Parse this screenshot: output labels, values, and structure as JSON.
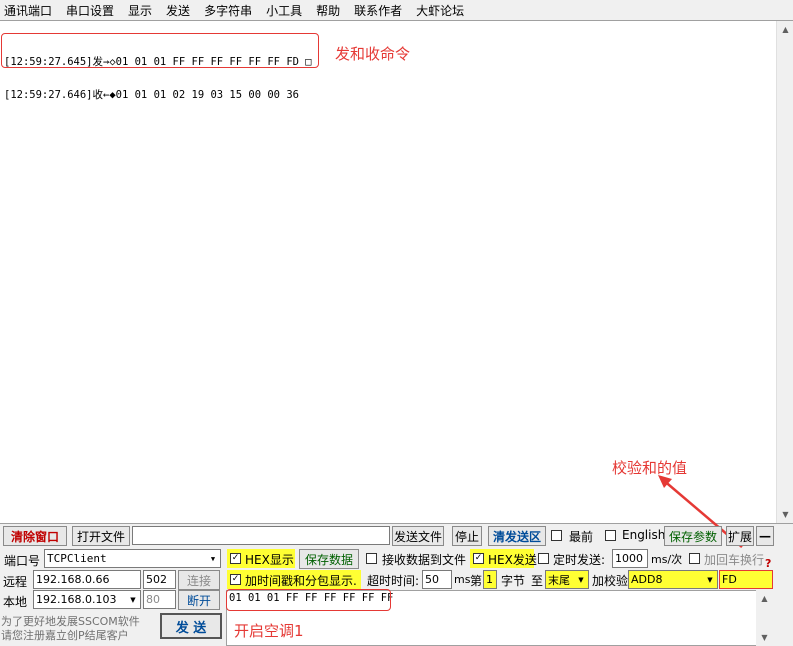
{
  "menu": [
    "通讯端口",
    "串口设置",
    "显示",
    "发送",
    "多字符串",
    "小工具",
    "帮助",
    "联系作者",
    "大虾论坛"
  ],
  "receive": {
    "lines": [
      "[12:59:27.645]发→◇01 01 01 FF FF FF FF FF FF FD □",
      "[12:59:27.646]收←◆01 01 01 02 19 03 15 00 00 36"
    ]
  },
  "annotations": {
    "send_recv": "发和收命令",
    "checksum_value": "校验和的值",
    "turn_on_ac": "开启空调1"
  },
  "toolbar": {
    "clear_window": "清除窗口",
    "open_file": "打开文件",
    "file_path": "",
    "send_file": "发送文件",
    "stop": "停止",
    "clear_send": "清发送区",
    "topmost": "最前",
    "english": "English",
    "save_params": "保存参数",
    "expand": "扩展",
    "collapse": "—"
  },
  "port": {
    "label": "端口号",
    "value": "TCPClient",
    "remote_label": "远程",
    "remote_ip": "192.168.0.66",
    "remote_port": "502",
    "connect": "连接",
    "local_label": "本地",
    "local_ip": "192.168.0.103",
    "local_port": "80",
    "disconnect": "断开"
  },
  "options": {
    "hex_display": "HEX显示",
    "save_data": "保存数据",
    "recv_to_file": "接收数据到文件",
    "hex_send": "HEX发送",
    "timed_send": "定时发送:",
    "interval": "1000",
    "interval_unit": "ms/次",
    "add_newline": "加回车换行",
    "timestamp": "加时间戳和分包显示.",
    "timeout_label": "超时时间:",
    "timeout_value": "50",
    "timeout_unit": "ms",
    "byte_prefix": "第",
    "byte_index": "1",
    "byte_label": "字节",
    "to": "至",
    "end": "末尾",
    "checksum_label": "加校验",
    "checksum_type": "ADD8",
    "checksum_result": "FD"
  },
  "send": {
    "text": "01 01 01 FF FF FF FF FF FF",
    "button": "发 送"
  },
  "promo": {
    "line1": "为了更好地发展SSCOM软件",
    "line2": "请您注册嘉立创P结尾客户"
  }
}
